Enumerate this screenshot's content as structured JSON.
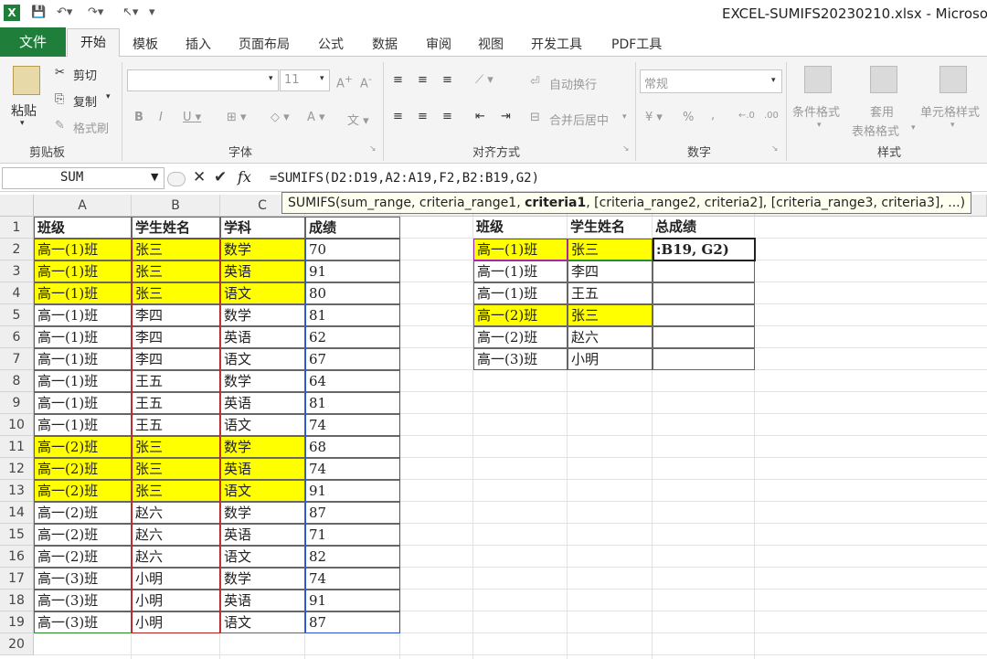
{
  "window": {
    "title": "EXCEL-SUMIFS20230210.xlsx - Microsof"
  },
  "tabs": [
    "文件",
    "开始",
    "插入",
    "页面布局",
    "公式",
    "数据",
    "审阅",
    "视图",
    "开发工具",
    "PDF工具"
  ],
  "tabs_extra": "模板",
  "ribbon": {
    "clipboard": {
      "paste": "粘贴",
      "cut": "剪切",
      "copy": "复制",
      "format_painter": "格式刷",
      "label": "剪贴板"
    },
    "font": {
      "size": "11",
      "label": "字体"
    },
    "alignment": {
      "wrap": "自动换行",
      "merge": "合并后居中",
      "label": "对齐方式"
    },
    "number": {
      "format": "常规",
      "percent": "%",
      "comma": ",",
      "label": "数字"
    },
    "styles": {
      "conditional": "条件格式",
      "table": "套用",
      "table2": "表格格式",
      "cell": "单元格样式",
      "label": "样式"
    }
  },
  "formula_bar": {
    "name_box": "SUM",
    "formula": "=SUMIFS(D2:D19,A2:A19,F2,B2:B19,G2)",
    "tooltip_pre": "SUMIFS(sum_range, criteria_range1, ",
    "tooltip_bold": "criteria1",
    "tooltip_post": ", [criteria_range2, criteria2], [criteria_range3, criteria3], ...)"
  },
  "columns": [
    "A",
    "B",
    "C"
  ],
  "rows": [
    "1",
    "2",
    "3",
    "4",
    "5",
    "6",
    "7",
    "8",
    "9",
    "10",
    "11",
    "12",
    "13",
    "14",
    "15",
    "16",
    "17",
    "18",
    "19",
    "20"
  ],
  "table1": {
    "headers": [
      "班级",
      "学生姓名",
      "学科",
      "成绩"
    ],
    "rows": [
      [
        "高一(1)班",
        "张三",
        "数学",
        "70"
      ],
      [
        "高一(1)班",
        "张三",
        "英语",
        "91"
      ],
      [
        "高一(1)班",
        "张三",
        "语文",
        "80"
      ],
      [
        "高一(1)班",
        "李四",
        "数学",
        "81"
      ],
      [
        "高一(1)班",
        "李四",
        "英语",
        "62"
      ],
      [
        "高一(1)班",
        "李四",
        "语文",
        "67"
      ],
      [
        "高一(1)班",
        "王五",
        "数学",
        "64"
      ],
      [
        "高一(1)班",
        "王五",
        "英语",
        "81"
      ],
      [
        "高一(1)班",
        "王五",
        "语文",
        "74"
      ],
      [
        "高一(2)班",
        "张三",
        "数学",
        "68"
      ],
      [
        "高一(2)班",
        "张三",
        "英语",
        "74"
      ],
      [
        "高一(2)班",
        "张三",
        "语文",
        "91"
      ],
      [
        "高一(2)班",
        "赵六",
        "数学",
        "87"
      ],
      [
        "高一(2)班",
        "赵六",
        "英语",
        "71"
      ],
      [
        "高一(2)班",
        "赵六",
        "语文",
        "82"
      ],
      [
        "高一(3)班",
        "小明",
        "数学",
        "74"
      ],
      [
        "高一(3)班",
        "小明",
        "英语",
        "91"
      ],
      [
        "高一(3)班",
        "小明",
        "语文",
        "87"
      ]
    ],
    "highlight_rows": [
      0,
      1,
      2,
      9,
      10,
      11
    ]
  },
  "table2": {
    "headers": [
      "班级",
      "学生姓名",
      "总成绩"
    ],
    "rows": [
      [
        "高一(1)班",
        "张三",
        ":B19, G2)"
      ],
      [
        "高一(1)班",
        "李四",
        ""
      ],
      [
        "高一(1)班",
        "王五",
        ""
      ],
      [
        "高一(2)班",
        "张三",
        ""
      ],
      [
        "高一(2)班",
        "赵六",
        ""
      ],
      [
        "高一(3)班",
        "小明",
        ""
      ]
    ],
    "highlight_rows": [
      0,
      3
    ]
  },
  "colors": {
    "file_tab": "#1e7e3a",
    "highlight": "#ffff00"
  }
}
